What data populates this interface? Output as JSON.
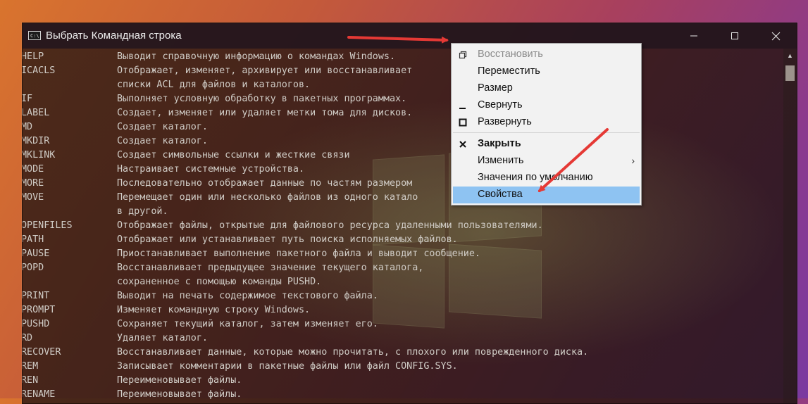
{
  "window": {
    "title": "Выбрать Командная строка",
    "icon_label": "C:\\",
    "controls": [
      "minimize-icon",
      "maximize-icon",
      "close-icon"
    ]
  },
  "console_rows": [
    {
      "cmd": "HELP",
      "desc": "Выводит справочную информацию о командах Windows."
    },
    {
      "cmd": "ICACLS",
      "desc": "Отображает, изменяет, архивирует или восстанавливает"
    },
    {
      "cmd": "",
      "desc": "списки ACL для файлов и каталогов."
    },
    {
      "cmd": "IF",
      "desc": "Выполняет условную обработку в пакетных программах."
    },
    {
      "cmd": "LABEL",
      "desc": "Создает, изменяет или удаляет метки тома для дисков."
    },
    {
      "cmd": "MD",
      "desc": "Создает каталог."
    },
    {
      "cmd": "MKDIR",
      "desc": "Создает каталог."
    },
    {
      "cmd": "MKLINK",
      "desc": "Создает символьные ссылки и жесткие связи"
    },
    {
      "cmd": "MODE",
      "desc": "Настраивает системные устройства."
    },
    {
      "cmd": "MORE",
      "desc": "Последовательно отображает данные по частям размером"
    },
    {
      "cmd": "MOVE",
      "desc": "Перемещает один или несколько файлов из одного катало"
    },
    {
      "cmd": "",
      "desc": "в другой."
    },
    {
      "cmd": "OPENFILES",
      "desc": "Отображает файлы, открытые для файлового ресурса удаленными пользователями."
    },
    {
      "cmd": "PATH",
      "desc": "Отображает или устанавливает путь поиска исполняемых файлов."
    },
    {
      "cmd": "PAUSE",
      "desc": "Приостанавливает выполнение пакетного файла и выводит сообщение."
    },
    {
      "cmd": "POPD",
      "desc": "Восстанавливает предыдущее значение текущего каталога,"
    },
    {
      "cmd": "",
      "desc": "сохраненное с помощью команды PUSHD."
    },
    {
      "cmd": "PRINT",
      "desc": "Выводит на печать содержимое текстового файла."
    },
    {
      "cmd": "PROMPT",
      "desc": "Изменяет командную строку Windows."
    },
    {
      "cmd": "PUSHD",
      "desc": "Сохраняет текущий каталог, затем изменяет его."
    },
    {
      "cmd": "RD",
      "desc": "Удаляет каталог."
    },
    {
      "cmd": "RECOVER",
      "desc": "Восстанавливает данные, которые можно прочитать, с плохого или поврежденного диска."
    },
    {
      "cmd": "REM",
      "desc": "Записывает комментарии в пакетные файлы или файл CONFIG.SYS."
    },
    {
      "cmd": "REN",
      "desc": "Переименовывает файлы."
    },
    {
      "cmd": "RENAME",
      "desc": "Переименовывает файлы."
    }
  ],
  "context_menu": {
    "items": [
      {
        "label": "Восстановить",
        "icon": "restore-icon",
        "state": "disabled"
      },
      {
        "label": "Переместить",
        "icon": "",
        "state": "normal"
      },
      {
        "label": "Размер",
        "icon": "",
        "state": "normal"
      },
      {
        "label": "Свернуть",
        "icon": "minimize-icon",
        "state": "normal"
      },
      {
        "label": "Развернуть",
        "icon": "maximize-icon",
        "state": "normal"
      },
      {
        "label": "Закрыть",
        "icon": "close-icon",
        "state": "bold"
      },
      {
        "label": "Изменить",
        "icon": "",
        "state": "submenu"
      },
      {
        "label": "Значения по умолчанию",
        "icon": "",
        "state": "normal"
      },
      {
        "label": "Свойства",
        "icon": "",
        "state": "highlighted"
      }
    ]
  },
  "colors": {
    "menu_highlight": "#8ec3f2",
    "annotation_arrow": "#e53935",
    "console_text": "#d0ccc6"
  }
}
